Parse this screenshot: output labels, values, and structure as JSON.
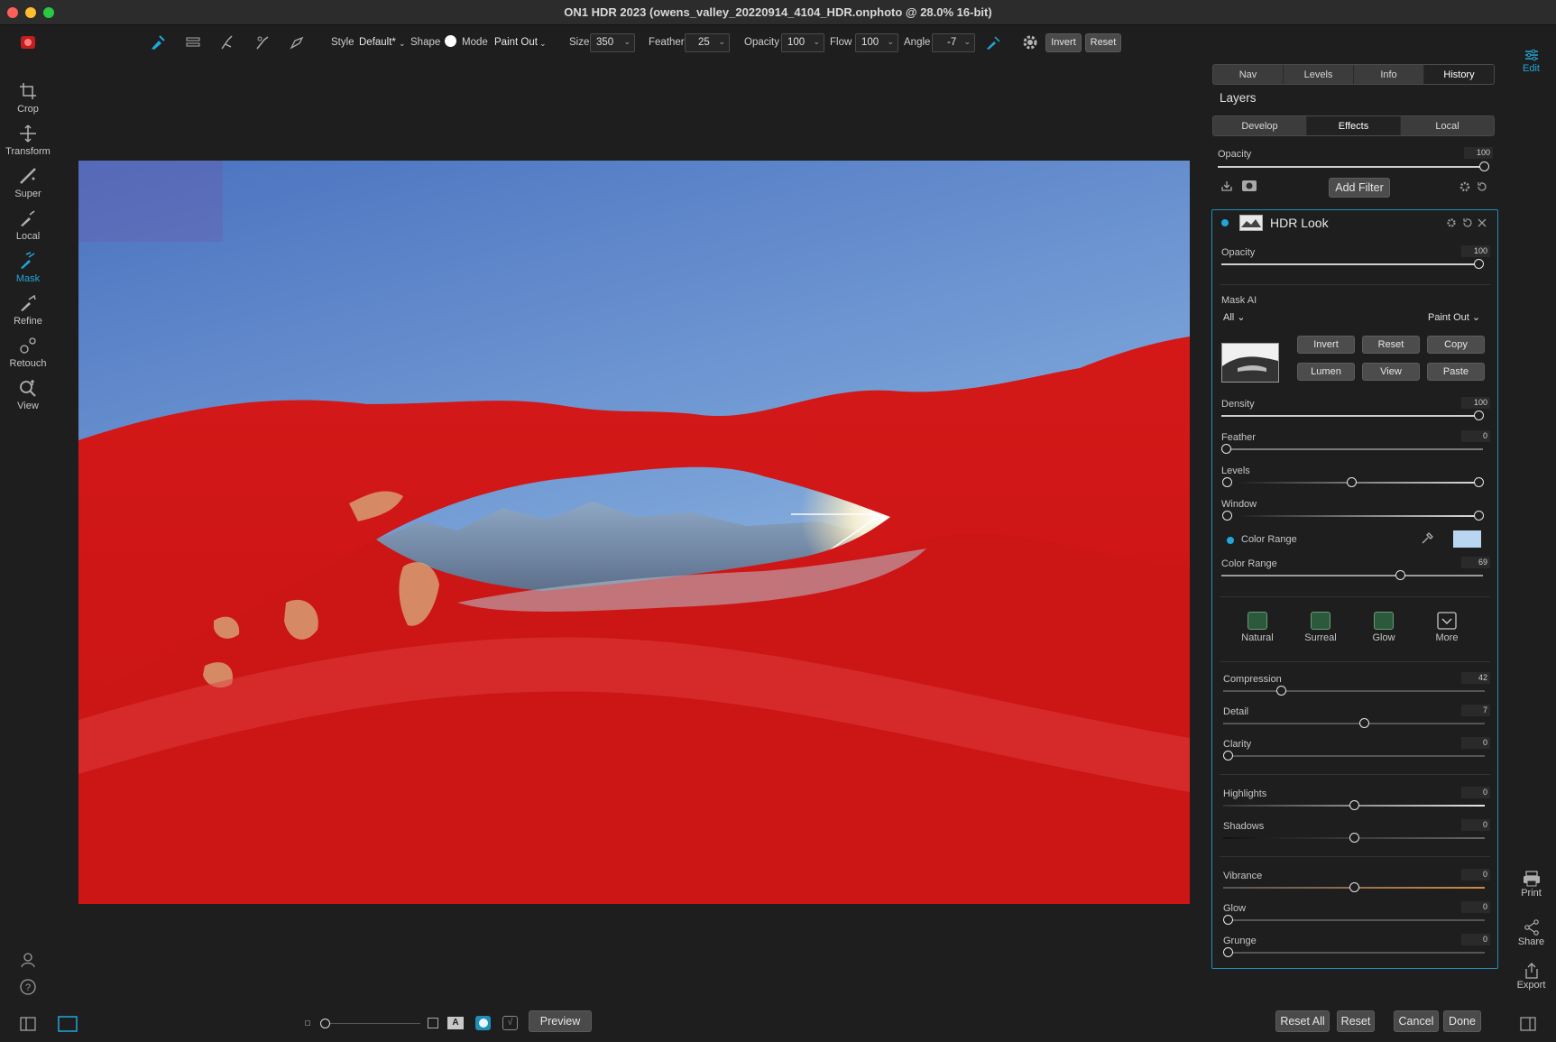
{
  "window": {
    "title": "ON1 HDR 2023 (owens_valley_20220914_4104_HDR.onphoto @ 28.0% 16-bit)"
  },
  "toolbar": {
    "style_label": "Style",
    "style_value": "Default*",
    "shape_label": "Shape",
    "mode_label": "Mode",
    "mode_value": "Paint Out",
    "size_label": "Size",
    "size_value": "350",
    "feather_label": "Feather",
    "feather_value": "25",
    "opacity_label": "Opacity",
    "opacity_value": "100",
    "flow_label": "Flow",
    "flow_value": "100",
    "angle_label": "Angle",
    "angle_value": "-7",
    "invert_label": "Invert",
    "reset_label": "Reset"
  },
  "left_tools": [
    {
      "label": "Crop",
      "icon": "crop-icon"
    },
    {
      "label": "Transform",
      "icon": "transform-icon"
    },
    {
      "label": "Super",
      "icon": "super-brush-icon"
    },
    {
      "label": "Local",
      "icon": "local-brush-icon"
    },
    {
      "label": "Mask",
      "icon": "mask-brush-icon",
      "active": true
    },
    {
      "label": "Refine",
      "icon": "refine-brush-icon"
    },
    {
      "label": "Retouch",
      "icon": "retouch-icon"
    },
    {
      "label": "View",
      "icon": "view-zoom-icon"
    }
  ],
  "panel": {
    "top_tabs": [
      "Nav",
      "Levels",
      "Info",
      "History"
    ],
    "layers_title": "Layers",
    "module_tabs": [
      "Develop",
      "Effects",
      "Local"
    ],
    "selected_module_tab": "Effects",
    "opacity_label": "Opacity",
    "opacity_value": "100",
    "opacity_level": 1.0,
    "add_filter_label": "Add Filter",
    "filter": {
      "name": "HDR Look",
      "opacity_label": "Opacity",
      "opacity_value": "100",
      "opacity_level": 1.0,
      "mask_ai_label": "Mask AI",
      "mask_ai_scope": "All",
      "mask_ai_mode": "Paint Out",
      "buttons": [
        "Invert",
        "Reset",
        "Copy",
        "Lumen",
        "View",
        "Paste"
      ],
      "density_label": "Density",
      "density_value": "100",
      "density_level": 1.0,
      "feather_label": "Feather",
      "feather_value": "0",
      "feather_level": 0.0,
      "levels_label": "Levels",
      "window_label": "Window",
      "color_range_toggle_label": "Color Range",
      "color_range_swatch": "#b8d6f2",
      "color_range_label": "Color Range",
      "color_range_value": "69",
      "color_range_level": 0.69,
      "presets": [
        "Natural",
        "Surreal",
        "Glow",
        "More"
      ],
      "compression_label": "Compression",
      "compression_value": "42",
      "compression_level": 0.21,
      "detail_label": "Detail",
      "detail_value": "7",
      "detail_level": 0.54,
      "clarity_label": "Clarity",
      "clarity_value": "0",
      "clarity_level": 0.0,
      "highlights_label": "Highlights",
      "highlights_value": "0",
      "highlights_level": 0.5,
      "shadows_label": "Shadows",
      "shadows_value": "0",
      "shadows_level": 0.5,
      "vibrance_label": "Vibrance",
      "vibrance_value": "0",
      "vibrance_level": 0.5,
      "glow_label": "Glow",
      "glow_value": "0",
      "glow_level": 0.0,
      "grunge_label": "Grunge",
      "grunge_value": "0",
      "grunge_level": 0.0
    }
  },
  "far_right": {
    "edit_label": "Edit",
    "print_label": "Print",
    "share_label": "Share",
    "export_label": "Export"
  },
  "bottom": {
    "preview_label": "Preview",
    "reset_all_label": "Reset All",
    "reset_label": "Reset",
    "cancel_label": "Cancel",
    "done_label": "Done"
  },
  "colors": {
    "accent": "#20a7d8",
    "mask_overlay": "#d81a1a",
    "sky_top": "#4d78c2",
    "sky_bottom": "#9ec2e6"
  }
}
